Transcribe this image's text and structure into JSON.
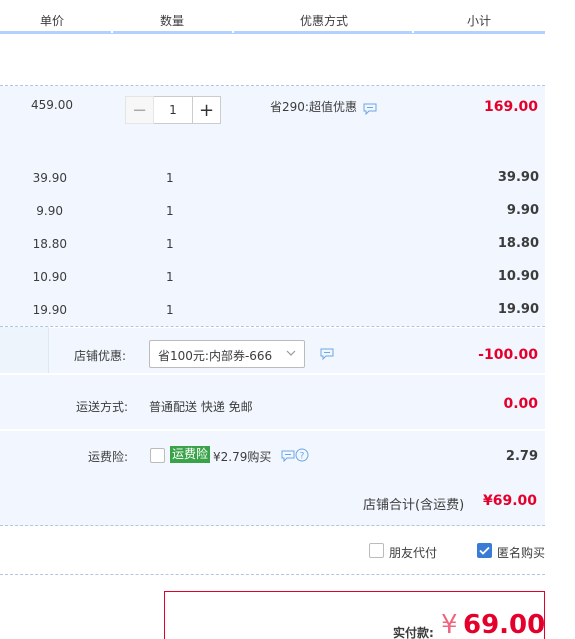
{
  "header": {
    "unit_price": "单价",
    "quantity": "数量",
    "discount_method": "优惠方式",
    "subtotal": "小计"
  },
  "main_item": {
    "price": "459.00",
    "qty": "1",
    "promo": "省290:超值优惠",
    "subtotal": "169.00"
  },
  "sub_items": [
    {
      "price": "39.90",
      "qty": "1",
      "subtotal": "39.90"
    },
    {
      "price": "9.90",
      "qty": "1",
      "subtotal": "9.90"
    },
    {
      "price": "18.80",
      "qty": "1",
      "subtotal": "18.80"
    },
    {
      "price": "10.90",
      "qty": "1",
      "subtotal": "10.90"
    },
    {
      "price": "19.90",
      "qty": "1",
      "subtotal": "19.90"
    }
  ],
  "store_discount": {
    "label": "店铺优惠:",
    "selected": "省100元:内部券-666",
    "amount": "-100.00"
  },
  "shipping": {
    "label": "运送方式:",
    "value": "普通配送 快递 免邮",
    "amount": "0.00"
  },
  "insurance": {
    "label": "运费险:",
    "badge": "运费险",
    "offer": "¥2.79购买",
    "amount": "2.79"
  },
  "store_total": {
    "label": "店铺合计(含运费)",
    "amount": "¥69.00"
  },
  "options": {
    "friend_pay": "朋友代付",
    "anonymous": "匿名购买"
  },
  "payment": {
    "label": "实付款:",
    "currency": "¥",
    "amount": "69.00"
  },
  "colors": {
    "accent_red": "#e4002b",
    "row_bg": "#f2f7ff",
    "header_line": "#b2d1ff",
    "checkbox_blue": "#3a7bd5",
    "badge_green": "#3aa34a"
  }
}
